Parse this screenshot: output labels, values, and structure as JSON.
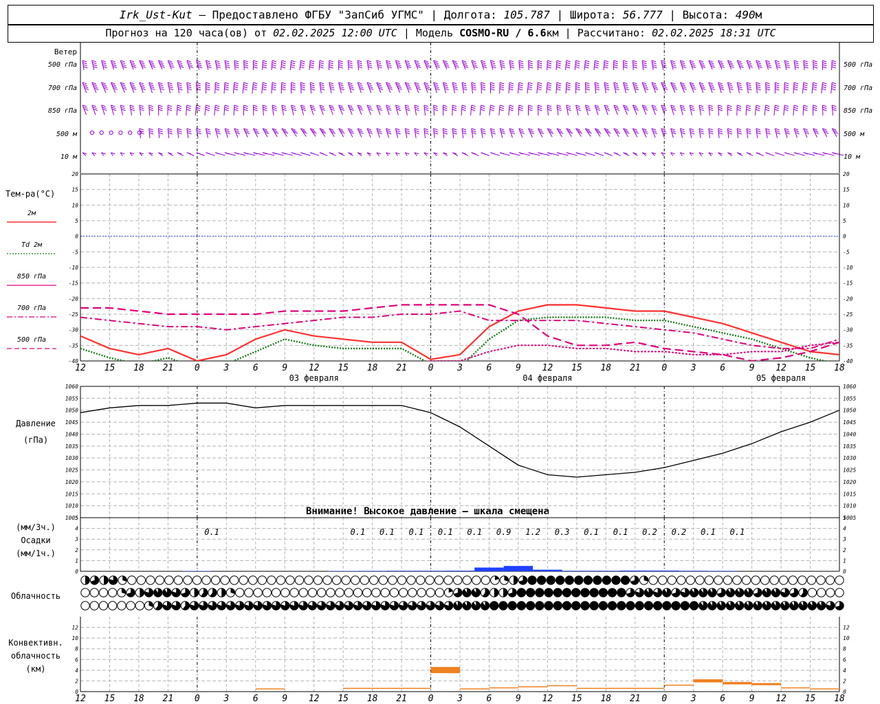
{
  "header": {
    "station": "Irk_Ust-Kut",
    "dash": "–",
    "provider": "Предоставлено ФГБУ \"ЗапСиб УГМС\"",
    "lon_label": "Долгота:",
    "lon_value": "105.787",
    "lat_label": "Широта:",
    "lat_value": "56.777",
    "alt_label": "Высота:",
    "alt_value": "490",
    "alt_unit": "м",
    "forecast_prefix": "Прогноз на 120 часа(ов) от",
    "forecast_start": "02.02.2025 12:00 UTC",
    "model_label": "Модель",
    "model_name": "COSMO-RU / 6.6",
    "model_unit": "км",
    "calc_label": "Рассчитано:",
    "calc_time": "02.02.2025 18:31 UTC",
    "sep": "|"
  },
  "colors": {
    "wind": "#9400d3",
    "t2m": "#ff3030",
    "td2m": "#1a7a1a",
    "t850": "#e0007a",
    "t700": "#e0007a",
    "t500": "#e0007a",
    "zero_line": "#3050ff",
    "pressure": "#000000",
    "precip": "#2040ff",
    "convective": "#f08020",
    "grid": "#b4b4b4"
  },
  "wind_panel": {
    "title": "Ветер",
    "levels_left": [
      "500 гПа",
      "700 гПа",
      "850 гПа",
      "500 м",
      "10  м"
    ],
    "levels_right": [
      "500 гПа",
      "700 гПа",
      "850 гПа",
      "500 м",
      "10  м"
    ]
  },
  "temp_panel": {
    "title": "Тем-ра(°C)",
    "legend": [
      {
        "label": "2м",
        "color": "#ff3030",
        "dash": "solid"
      },
      {
        "label": "Td  2м",
        "color": "#1a7a1a",
        "dash": "dot"
      },
      {
        "label": "850 гПа",
        "color": "#e0007a",
        "dash": "solid-thin"
      },
      {
        "label": "700 гПа",
        "color": "#e0007a",
        "dash": "dashdot"
      },
      {
        "label": "500 гПа",
        "color": "#e0007a",
        "dash": "dash"
      }
    ]
  },
  "pressure_panel": {
    "title": "Давление",
    "unit": "(гПа)",
    "warning": "Внимание! Высокое давление – шкала смещена"
  },
  "precip_panel": {
    "unit_3h": "(мм/3ч.)",
    "title": "Осадки",
    "unit_1h": "(мм/1ч.)"
  },
  "cloud_panel": {
    "title": "Облачность"
  },
  "conv_panel": {
    "title_1": "Конвективн.",
    "title_2": "облачность",
    "unit": "(км)"
  },
  "time_axis": {
    "hour_labels": [
      "12",
      "15",
      "18",
      "21",
      "0",
      "3",
      "6",
      "9",
      "12",
      "15",
      "18",
      "21",
      "0",
      "3",
      "6",
      "9",
      "12",
      "15",
      "18",
      "21",
      "0",
      "3",
      "6",
      "9",
      "12",
      "15",
      "18"
    ],
    "date_labels": [
      {
        "text": "03 февраля",
        "at_index": 8
      },
      {
        "text": "04 февраля",
        "at_index": 16
      },
      {
        "text": "05 февраля",
        "at_index": 24
      }
    ]
  },
  "chart_data": [
    {
      "type": "line",
      "title": "Тем-ра(°C)",
      "x_hours": [
        0,
        3,
        6,
        9,
        12,
        15,
        18,
        21,
        24,
        27,
        30,
        33,
        36,
        39,
        42,
        45,
        48,
        51,
        54,
        57,
        60,
        63,
        66,
        69,
        72,
        75,
        78
      ],
      "ylim": [
        -40,
        20
      ],
      "yticks": [
        20,
        15,
        10,
        5,
        0,
        -5,
        -10,
        -15,
        -20,
        -25,
        -30,
        -35,
        -40
      ],
      "series": [
        {
          "name": "2м",
          "values": [
            -32,
            -36,
            -38,
            -36,
            -40,
            -38,
            -33,
            -30,
            -32,
            -33,
            -34,
            -34,
            -39.5,
            -38,
            -29,
            -24,
            -22,
            -22,
            -23,
            -24,
            -24,
            -26,
            -28,
            -31,
            -34,
            -37,
            -38
          ]
        },
        {
          "name": "Td  2м",
          "values": [
            -36,
            -39,
            -41,
            -39,
            -42,
            -41,
            -37,
            -33,
            -35,
            -36,
            -36,
            -36,
            -41,
            -42,
            -33,
            -27,
            -26,
            -26,
            -26,
            -27,
            -27,
            -29,
            -31,
            -33,
            -36,
            -39,
            -41
          ]
        },
        {
          "name": "850 гПа",
          "values": [
            -46,
            -45,
            -45,
            -44,
            -44,
            -43,
            -43,
            -42,
            -42,
            -41,
            -41,
            -41,
            -40,
            -40,
            -37,
            -35,
            -35,
            -36,
            -36,
            -37,
            -37,
            -38,
            -38,
            -37,
            -37,
            -35,
            -34
          ]
        },
        {
          "name": "700 гПа",
          "values": [
            -26,
            -27,
            -28,
            -29,
            -29,
            -30,
            -29,
            -28,
            -27,
            -26,
            -26,
            -25,
            -25,
            -24,
            -27,
            -27,
            -27,
            -27,
            -28,
            -29,
            -30,
            -31,
            -33,
            -35,
            -36,
            -36,
            -33
          ]
        },
        {
          "name": "500 гПа",
          "values": [
            -23,
            -23,
            -24,
            -25,
            -25,
            -25,
            -25,
            -24,
            -24,
            -24,
            -23,
            -22,
            -22,
            -22,
            -22,
            -25,
            -32,
            -35,
            -35,
            -34,
            -36,
            -37,
            -38,
            -40,
            -39,
            -37,
            -34
          ]
        }
      ]
    },
    {
      "type": "line",
      "title": "Давление",
      "ylabel": "(гПа)",
      "x_hours": [
        0,
        3,
        6,
        9,
        12,
        15,
        18,
        21,
        24,
        27,
        30,
        33,
        36,
        39,
        42,
        45,
        48,
        51,
        54,
        57,
        60,
        63,
        66,
        69,
        72,
        75,
        78
      ],
      "ylim": [
        1005,
        1060
      ],
      "yticks": [
        1060,
        1055,
        1050,
        1045,
        1040,
        1035,
        1030,
        1025,
        1020,
        1015,
        1010,
        1005
      ],
      "series": [
        {
          "name": "",
          "values": [
            1049,
            1051,
            1052,
            1052,
            1053,
            1053,
            1051,
            1052,
            1052,
            1052,
            1052,
            1052,
            1049,
            1043,
            1035,
            1027,
            1023,
            1022,
            1023,
            1024,
            1026,
            1029,
            1032,
            1036,
            1041,
            1045,
            1050
          ]
        }
      ]
    },
    {
      "type": "bar",
      "title": "Осадки",
      "x_hours": [
        0,
        3,
        6,
        9,
        12,
        15,
        18,
        21,
        24,
        27,
        30,
        33,
        36,
        39,
        42,
        45,
        48,
        51,
        54,
        57,
        60,
        63,
        66,
        69,
        72,
        75,
        78
      ],
      "ylim": [
        0,
        5
      ],
      "yticks": [
        5,
        4,
        3,
        2,
        1,
        0
      ],
      "labels_3h": [
        "",
        "",
        "",
        "",
        "0.1",
        "",
        "",
        "",
        "",
        "0.1",
        "0.1",
        "0.1",
        "0.1",
        "0.1",
        "0.9",
        "1.2",
        "0.3",
        "0.1",
        "0.1",
        "0.2",
        "0.2",
        "0.1",
        "0.1",
        "",
        "",
        "",
        ""
      ],
      "values_1h": [
        0,
        0,
        0,
        0,
        0.03,
        0,
        0,
        0,
        0,
        0.03,
        0.04,
        0.05,
        0.05,
        0.06,
        0.35,
        0.5,
        0.15,
        0.05,
        0.05,
        0.07,
        0.07,
        0.05,
        0.04,
        0,
        0,
        0,
        0
      ]
    },
    {
      "type": "bar",
      "title": "Конвективн. облачность",
      "ylabel": "(км)",
      "x_hours": [
        0,
        3,
        6,
        9,
        12,
        15,
        18,
        21,
        24,
        27,
        30,
        33,
        36,
        39,
        42,
        45,
        48,
        51,
        54,
        57,
        60,
        63,
        66,
        69,
        72,
        75,
        78
      ],
      "ylim": [
        0,
        14
      ],
      "yticks": [
        12,
        10,
        8,
        6,
        4,
        2,
        0
      ],
      "values": [
        0,
        0,
        0,
        0,
        0,
        0,
        0.6,
        0,
        0,
        0.7,
        0.7,
        0.7,
        4.6,
        0.6,
        0.8,
        1.0,
        1.2,
        0.7,
        0.7,
        0.7,
        1.3,
        2.3,
        1.8,
        1.6,
        0.8,
        0.6,
        0
      ]
    }
  ],
  "cloud_data": {
    "rows": [
      "upper",
      "middle",
      "lower"
    ],
    "cover_upper": [
      0.5,
      0.7,
      0.5,
      0.8,
      0.3,
      0,
      0,
      0,
      0,
      0,
      0,
      0,
      0,
      0,
      0,
      0,
      0,
      0,
      0,
      0,
      0,
      0,
      0,
      0,
      0,
      0,
      0,
      0,
      0,
      0,
      0,
      0,
      0,
      0,
      0,
      0,
      0,
      0,
      0,
      0,
      0,
      0,
      0,
      0,
      0.2,
      0.3,
      0.5,
      0.7,
      1,
      1,
      1,
      1,
      1,
      1,
      1,
      1,
      1,
      1,
      1,
      0.7,
      0.3,
      0,
      0,
      0,
      0,
      0,
      0,
      0,
      0,
      0,
      0,
      0,
      0,
      0,
      0,
      0,
      0,
      0,
      0,
      0,
      0,
      0
    ],
    "cover_middle": [
      0,
      0,
      0,
      0,
      0.3,
      0.7,
      0.5,
      0.8,
      0.9,
      0.9,
      0.8,
      0.7,
      0.5,
      0.6,
      0.6,
      0.5,
      0.3,
      0,
      0,
      0,
      0,
      0,
      0,
      0,
      0,
      0,
      0,
      0,
      0,
      0,
      0,
      0,
      0,
      0,
      0,
      0,
      0,
      0,
      0,
      0,
      0.2,
      0.7,
      0.9,
      0.9,
      0.6,
      0.5,
      0.5,
      0.7,
      1,
      1,
      1,
      1,
      1,
      1,
      1,
      1,
      1,
      1,
      1,
      1,
      0.7,
      0.8,
      0.9,
      0.8,
      0.9,
      0.7,
      0.8,
      0.9,
      0.9,
      0.9,
      0.7,
      0.9,
      0.9,
      0.9,
      0.7,
      0.9,
      0.9,
      0.8,
      0.7,
      0.6,
      0,
      0,
      0,
      0
    ],
    "cover_lower": [
      0,
      0,
      0,
      0,
      0,
      0,
      0,
      0.3,
      0.6,
      0.8,
      0.8,
      0.6,
      0.8,
      0.8,
      0.8,
      0.8,
      0.8,
      0.8,
      0.8,
      0.8,
      0.8,
      0.8,
      0.8,
      0.8,
      0.8,
      0.8,
      0.8,
      0.8,
      0.8,
      0.8,
      0.8,
      0.8,
      0.8,
      0.8,
      0.8,
      0.8,
      0.8,
      0.8,
      0.8,
      0.8,
      0.8,
      0.9,
      0.9,
      0.9,
      0.9,
      1,
      1,
      1,
      1,
      1,
      1,
      1,
      1,
      1,
      1,
      1,
      1,
      1,
      1,
      1,
      1,
      1,
      1,
      1,
      1,
      1,
      1,
      1,
      0.9,
      0.9,
      0.9,
      0.9,
      0.9,
      0.9,
      0.9,
      0.9,
      0.9,
      0.9,
      0.9,
      0.9,
      0.9,
      0.9,
      0.8,
      0.7
    ]
  }
}
